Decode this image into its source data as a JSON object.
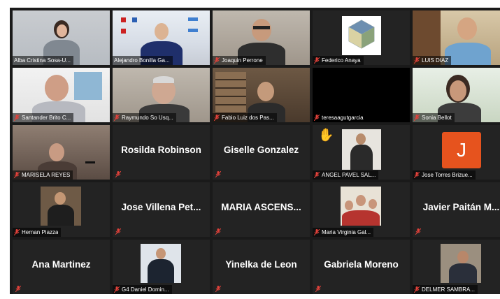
{
  "meeting": {
    "tiles": [
      {
        "name": "Alba Cristina Sosa-U...",
        "type": "video",
        "bg": "v-wall",
        "active": true
      },
      {
        "name": "Alejandro Bonilla Ga...",
        "type": "video",
        "bg": "v-office"
      },
      {
        "name": "Joaquin Perrone",
        "type": "video",
        "bg": "v-room"
      },
      {
        "name": "Federico Anaya",
        "type": "logo"
      },
      {
        "name": "LUIS DIAZ",
        "type": "video",
        "bg": "v-warm"
      },
      {
        "name": "Santander Brito C...",
        "type": "video",
        "bg": "v-white"
      },
      {
        "name": "Raymundo So Usq...",
        "type": "video",
        "bg": "v-room"
      },
      {
        "name": "Fabio Luiz dos Pas...",
        "type": "video",
        "bg": "v-shelf"
      },
      {
        "name": "teresaagutgarcia",
        "type": "blank"
      },
      {
        "name": "Sonia Bellot",
        "type": "video",
        "bg": "v-bright"
      },
      {
        "name": "MARISELA REYES",
        "type": "video",
        "bg": "v-dusk"
      },
      {
        "name": "Rosilda Robinson",
        "type": "text"
      },
      {
        "name": "Giselle Gonzalez",
        "type": "text"
      },
      {
        "name": "ANGEL PAVEL SAL...",
        "type": "photo"
      },
      {
        "name": "Jose Torres Brizue...",
        "type": "avatar",
        "initial": "J"
      },
      {
        "name": "Hernan Piazza",
        "type": "photo"
      },
      {
        "name": "Jose Villena Pet...",
        "type": "text"
      },
      {
        "name": "MARIA ASCENS...",
        "type": "text"
      },
      {
        "name": "Maria Virginia Gal...",
        "type": "photo"
      },
      {
        "name": "Javier Paitán M...",
        "type": "text"
      },
      {
        "name": "Ana Martinez",
        "type": "text"
      },
      {
        "name": "G4 Daniel Domin...",
        "type": "photo"
      },
      {
        "name": "Yinelka de Leon",
        "type": "text"
      },
      {
        "name": "Gabriela Moreno",
        "type": "text"
      },
      {
        "name": "DELMER SAMBRA...",
        "type": "photo"
      }
    ]
  },
  "colors": {
    "active_border": "#c9d84a",
    "muted_mic": "#e0413a",
    "tile_bg": "#232323",
    "avatar_orange": "#e6531e"
  },
  "icons": {
    "muted": "mic-muted-icon"
  }
}
